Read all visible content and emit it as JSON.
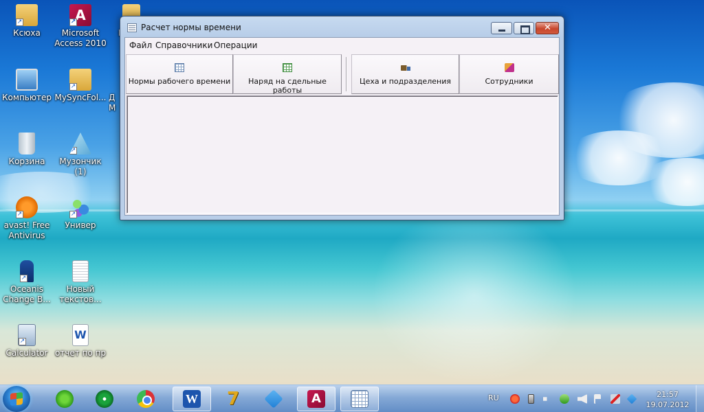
{
  "desktop": {
    "icons": [
      {
        "label": "Ксюха",
        "icon": "folder-icon"
      },
      {
        "label": "Microsoft Access 2010",
        "icon": "access-icon"
      },
      {
        "label": "Но",
        "icon": "folder-icon"
      },
      {
        "label": "Компьютер",
        "icon": "computer-icon"
      },
      {
        "label": "MySyncFol...",
        "icon": "sync-folder-icon"
      },
      {
        "label": "Д М",
        "icon": "folder-icon"
      },
      {
        "label": "Корзина",
        "icon": "recycle-bin-icon"
      },
      {
        "label": "Музончик (1)",
        "icon": "music-icon"
      },
      {
        "label": "avast! Free Antivirus",
        "icon": "avast-icon"
      },
      {
        "label": "Универ",
        "icon": "network-icon"
      },
      {
        "label": "Oceanis Change B...",
        "icon": "lock-icon"
      },
      {
        "label": "Новый текстов...",
        "icon": "text-file-icon"
      },
      {
        "label": "Calculator",
        "icon": "calculator-icon"
      },
      {
        "label": "отчет по пр",
        "icon": "word-doc-icon"
      }
    ]
  },
  "window": {
    "title": "Расчет нормы времени",
    "menu": [
      "Файл",
      "Справочники",
      "Операции"
    ],
    "toolbar": [
      {
        "label": "Нормы рабочего времени",
        "icon": "grid-icon"
      },
      {
        "label": "Наряд на сдельные работы",
        "icon": "table-icon"
      },
      {
        "label": "Цеха и подразделения",
        "icon": "truck-icon"
      },
      {
        "label": "Сотрудники",
        "icon": "people-icon"
      }
    ]
  },
  "taskbar": {
    "language": "RU",
    "time": "21:57",
    "date": "19.07.2012"
  },
  "colors": {
    "window_frame": "#b9cee8",
    "client_bg": "#f5f1f6",
    "close_button": "#c7462c",
    "taskbar": "#78a0d2"
  }
}
